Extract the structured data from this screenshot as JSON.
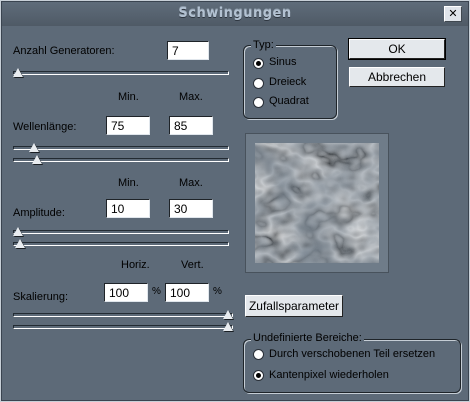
{
  "window": {
    "title": "Schwingungen",
    "close_label": "✕"
  },
  "fields": {
    "generators": {
      "label": "Anzahl Generatoren:",
      "value": "7"
    },
    "wavelength": {
      "label": "Wellenlänge:",
      "min": "75",
      "max": "85"
    },
    "amplitude": {
      "label": "Amplitude:",
      "min": "10",
      "max": "30"
    },
    "scaling": {
      "label": "Skalierung:",
      "horiz": "100",
      "vert": "100",
      "unit": "%"
    }
  },
  "column_headers": {
    "min": "Min.",
    "max": "Max.",
    "horiz": "Horiz.",
    "vert": "Vert."
  },
  "type_group": {
    "title": "Typ:",
    "options": [
      "Sinus",
      "Dreieck",
      "Quadrat"
    ],
    "selected": "Sinus"
  },
  "buttons": {
    "ok": "OK",
    "cancel": "Abbrechen",
    "random": "Zufallsparameter"
  },
  "undefined_group": {
    "title": "Undefinierte Bereiche:",
    "options": [
      "Durch verschobenen Teil ersetzen",
      "Kantenpixel wiederholen"
    ],
    "selected": "Kantenpixel wiederholen"
  },
  "sliders": {
    "generators": 0.0,
    "wavelength_min": 0.08,
    "wavelength_max": 0.09,
    "amplitude_min": 0.0,
    "amplitude_max": 0.01,
    "scaling_horiz": 1.0,
    "scaling_vert": 1.0
  },
  "icons": {
    "close": "close-icon",
    "preview": "wave-preview-image"
  }
}
